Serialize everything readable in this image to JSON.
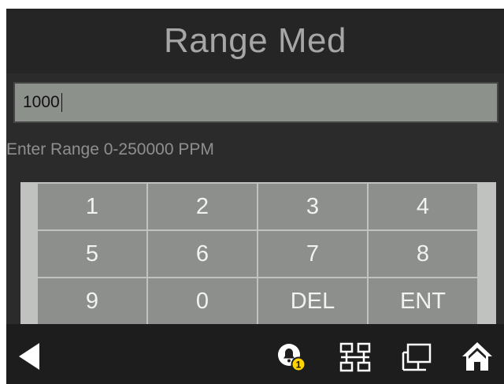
{
  "screen": {
    "title": "Range Med",
    "input": {
      "value": "1000"
    },
    "hint": "Enter Range 0-250000 PPM"
  },
  "keypad": {
    "keys": [
      "1",
      "2",
      "3",
      "4",
      "5",
      "6",
      "7",
      "8",
      "9",
      "0",
      "DEL",
      "ENT"
    ]
  },
  "nav": {
    "alarm_badge": "1",
    "icons": [
      "back-arrow-icon",
      "alarm-bell-icon",
      "network-icon",
      "display-icon",
      "home-icon"
    ]
  },
  "colors": {
    "background": "#2b2b2b",
    "input_fill": "#8c918c",
    "key_fill": "#8c8f8c",
    "alarm_badge": "#ffd400"
  }
}
